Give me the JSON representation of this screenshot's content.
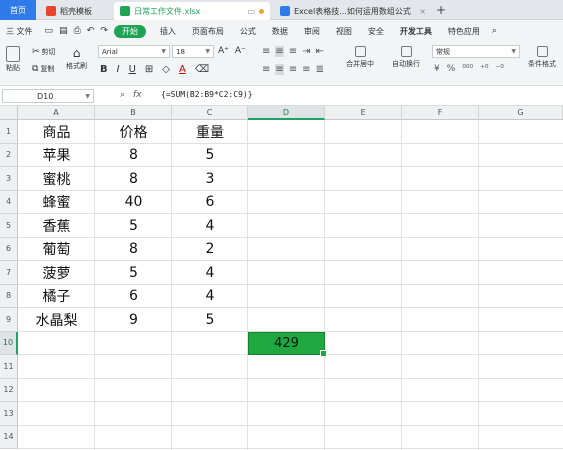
{
  "tabs": {
    "home": "首页",
    "templates": "稻壳模板",
    "file": "日常工作文件.xlsx",
    "article": "Excel表格技...如何运用数组公式"
  },
  "menu": {
    "file_menu": "三 文件",
    "start": "开始",
    "items": [
      "插入",
      "页面布局",
      "公式",
      "数据",
      "审阅",
      "视图",
      "安全",
      "开发工具",
      "特色应用"
    ]
  },
  "ribbon": {
    "paste": "粘贴",
    "cut": "剪切",
    "copy": "复制",
    "format_painter": "格式刷",
    "font_name": "Arial",
    "font_size": "18",
    "merge_center": "合并居中",
    "wrap_text": "自动换行",
    "number_format": "常规",
    "percent": "%",
    "conditional_format": "条件格式"
  },
  "formula_bar": {
    "name_box": "D10",
    "fx": "fx",
    "formula": "{=SUM(B2:B9*C2:C9)}"
  },
  "sheet": {
    "columns": [
      "A",
      "B",
      "C",
      "D",
      "E",
      "F",
      "G"
    ],
    "rows": [
      "1",
      "2",
      "3",
      "4",
      "5",
      "6",
      "7",
      "8",
      "9",
      "10",
      "11",
      "12",
      "13",
      "14"
    ],
    "header": [
      "商品",
      "价格",
      "重量"
    ],
    "data": [
      [
        "苹果",
        "8",
        "5"
      ],
      [
        "蜜桃",
        "8",
        "3"
      ],
      [
        "蜂蜜",
        "40",
        "6"
      ],
      [
        "香蕉",
        "5",
        "4"
      ],
      [
        "葡萄",
        "8",
        "2"
      ],
      [
        "菠萝",
        "5",
        "4"
      ],
      [
        "橘子",
        "6",
        "4"
      ],
      [
        "水晶梨",
        "9",
        "5"
      ]
    ],
    "result": "429"
  },
  "colors": {
    "accent_green": "#1fa83f",
    "home_blue": "#2f7bea"
  }
}
